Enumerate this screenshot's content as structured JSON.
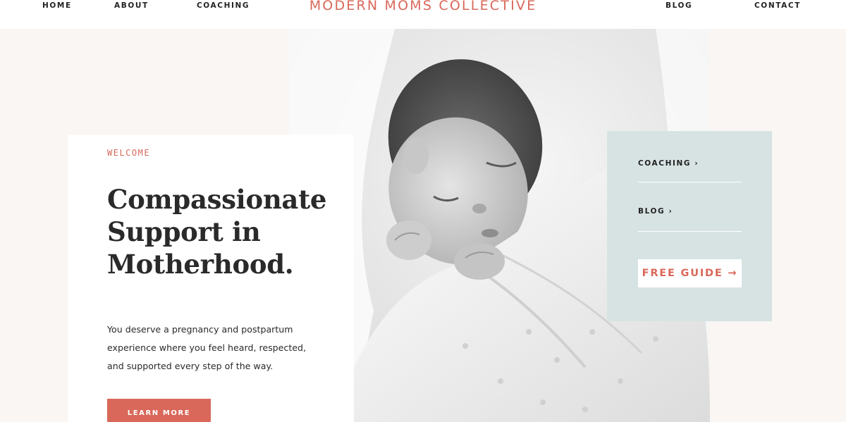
{
  "nav": {
    "home": "HOME",
    "about": "ABOUT",
    "coaching": "COACHING",
    "brand": "MODERN MOMS COLLECTIVE",
    "blog": "BLOG",
    "contact": "CONTACT"
  },
  "hero": {
    "eyebrow": "WELCOME",
    "headline_line1": "Compassionate",
    "headline_line2": "Support in",
    "headline_line3": "Motherhood.",
    "body_line1": "You deserve a pregnancy and postpartum",
    "body_line2": "experience where you feel heard, respected,",
    "body_line3": "and supported every step of the way.",
    "cta_label": "LEARN MORE"
  },
  "side_panel": {
    "link1": "COACHING ›",
    "link2": "BLOG ›",
    "guide_label": "FREE GUIDE →"
  },
  "colors": {
    "accent": "#d9685a",
    "panel": "#d7e3e3",
    "page_bg": "#f9f6f3"
  },
  "icons": {
    "photo": "sleeping-newborn-photo"
  }
}
